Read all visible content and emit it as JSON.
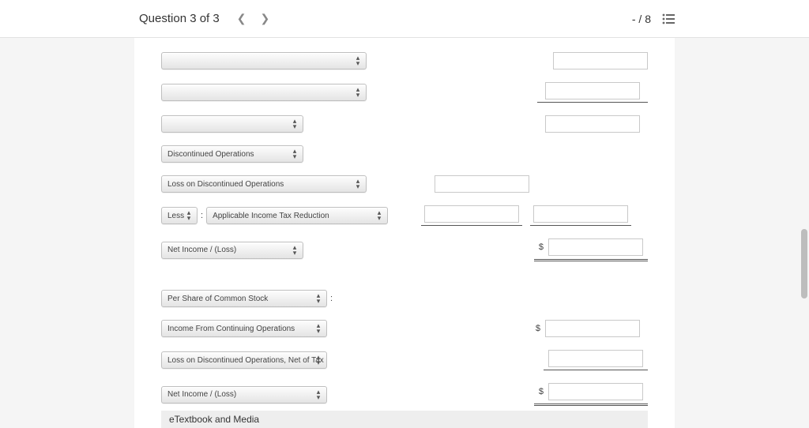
{
  "topbar": {
    "title": "Question 3 of 3",
    "score": "- / 8"
  },
  "rows": {
    "r4_sel": "Discontinued Operations",
    "r5_sel": "Loss on Discontinued Operations",
    "r6_less": "Less",
    "r6_sel": "Applicable Income Tax Reduction",
    "r7_sel": "Net Income / (Loss)",
    "r8_sel": "Per Share of Common Stock",
    "r9_sel": "Income From Continuing Operations",
    "r10_sel": "Loss on Discontinued Operations, Net of Tax",
    "r11_sel": "Net Income / (Loss)"
  },
  "symbols": {
    "colon": ":",
    "dollar": "$"
  },
  "footer": {
    "etext": "eTextbook and Media"
  }
}
